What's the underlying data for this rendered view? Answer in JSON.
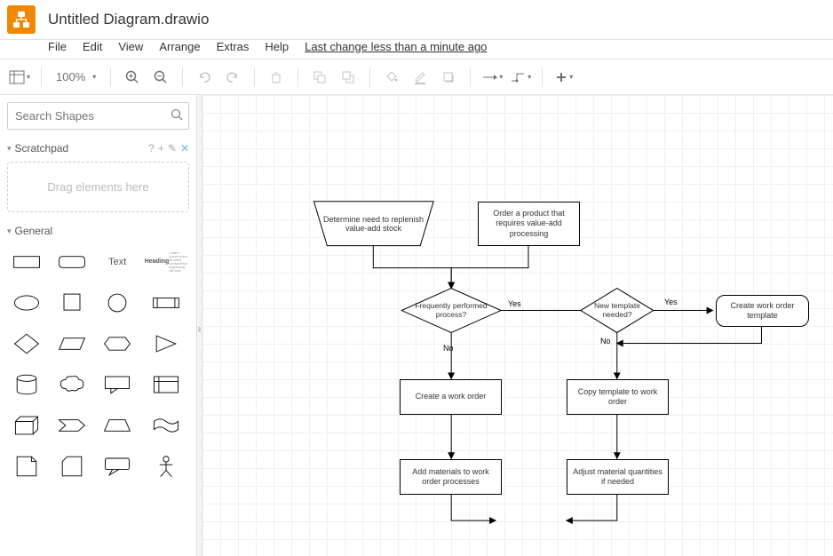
{
  "app": {
    "title": "Untitled Diagram.drawio"
  },
  "menu": {
    "file": "File",
    "edit": "Edit",
    "view": "View",
    "arrange": "Arrange",
    "extras": "Extras",
    "help": "Help",
    "lastchange": "Last change less than a minute ago"
  },
  "toolbar": {
    "zoom": "100%"
  },
  "sidebar": {
    "search_placeholder": "Search Shapes",
    "scratchpad": "Scratchpad",
    "drag_hint": "Drag elements here",
    "general": "General",
    "text_shape": "Text",
    "heading_shape": "Heading"
  },
  "nodes": {
    "n1": "Determine need to replenish value-add stock",
    "n2": "Order a product that requires value-add processing",
    "d1": "Frequently performed process?",
    "d2": "New template needed?",
    "r1": "Create work order template",
    "p1": "Create a work order",
    "p2": "Copy template to work order",
    "p3": "Add materials to work order processes",
    "p4": "Adjust material quantities if needed"
  },
  "labels": {
    "yes1": "Yes",
    "no1": "No",
    "yes2": "Yes",
    "no2": "No"
  }
}
